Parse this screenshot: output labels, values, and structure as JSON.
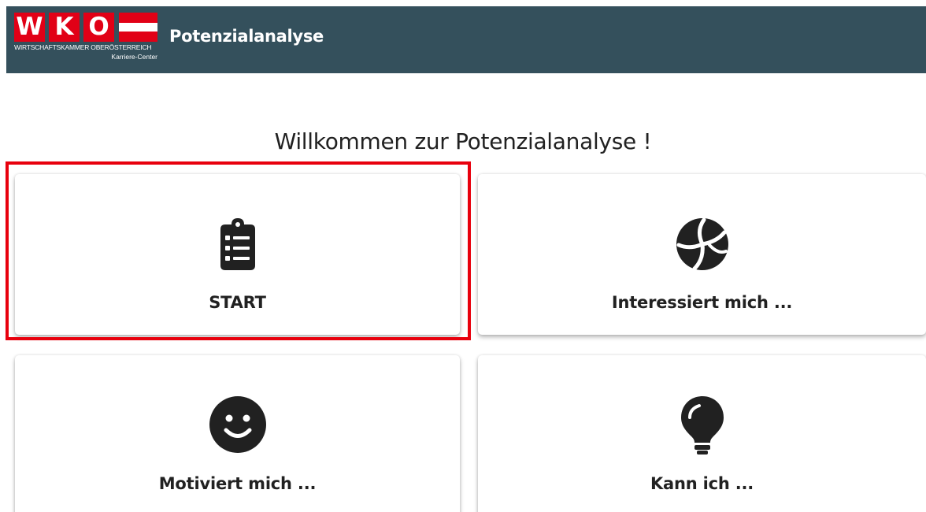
{
  "header": {
    "logo": {
      "letters": [
        "W",
        "K",
        "O"
      ],
      "subtitle": "WIRTSCHAFTSKAMMER OBERÖSTERREICH",
      "subtitle2": "Karriere-Center"
    },
    "title": "Potenzialanalyse"
  },
  "main": {
    "welcome": "Willkommen zur Potenzialanalyse !",
    "cards": [
      {
        "label": "START",
        "icon": "clipboard-list-icon",
        "highlighted": true
      },
      {
        "label": "Interessiert mich ...",
        "icon": "volleyball-icon"
      },
      {
        "label": "Motiviert mich ...",
        "icon": "smiley-face-icon"
      },
      {
        "label": "Kann ich ...",
        "icon": "lightbulb-icon"
      }
    ]
  },
  "colors": {
    "header_bg": "#34505c",
    "brand_red": "#e10016",
    "highlight": "#e8000d",
    "icon": "#212121"
  }
}
